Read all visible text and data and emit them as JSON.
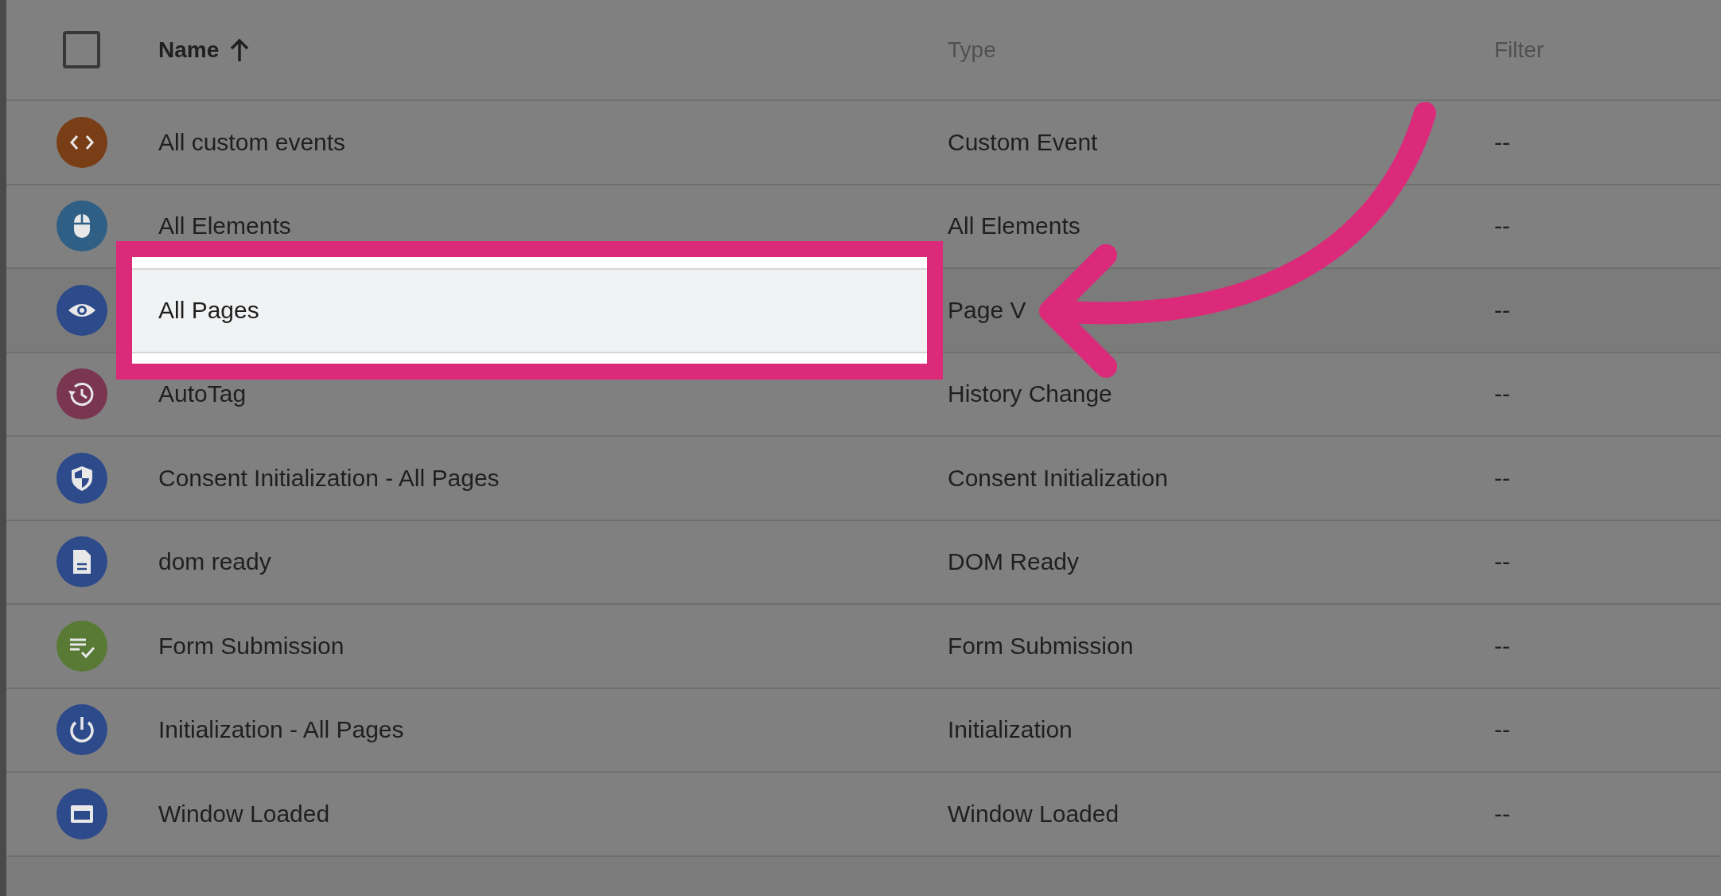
{
  "header": {
    "select_all": {
      "checked": false
    },
    "columns": [
      {
        "label": "Name",
        "sorted": true
      },
      {
        "label": "Type",
        "sorted": false
      },
      {
        "label": "Filter",
        "sorted": false
      }
    ]
  },
  "rows": [
    {
      "name": "All custom events",
      "type": "Custom Event",
      "filter": "--",
      "color": "#7a3e17",
      "highlighted": false
    },
    {
      "name": "All Elements",
      "type": "All Elements",
      "filter": "--",
      "color": "#2f5f85",
      "highlighted": false
    },
    {
      "name": "All Pages",
      "type": "Page V",
      "filter": "--",
      "color": "#2d4a8a",
      "highlighted": true
    },
    {
      "name": "AutoTag",
      "type": "History Change",
      "filter": "--",
      "color": "#7a3550",
      "highlighted": false
    },
    {
      "name": "Consent Initialization - All Pages",
      "type": "Consent Initialization",
      "filter": "--",
      "color": "#2d4a8a",
      "highlighted": false
    },
    {
      "name": "dom ready",
      "type": "DOM Ready",
      "filter": "--",
      "color": "#2d4a8a",
      "highlighted": false
    },
    {
      "name": "Form Submission",
      "type": "Form Submission",
      "filter": "--",
      "color": "#587a35",
      "highlighted": false
    },
    {
      "name": "Initialization - All Pages",
      "type": "Initialization",
      "filter": "--",
      "color": "#2d4a8a",
      "highlighted": false
    },
    {
      "name": "Window Loaded",
      "type": "Window Loaded",
      "filter": "--",
      "color": "#2d4a8a",
      "highlighted": false
    }
  ]
}
